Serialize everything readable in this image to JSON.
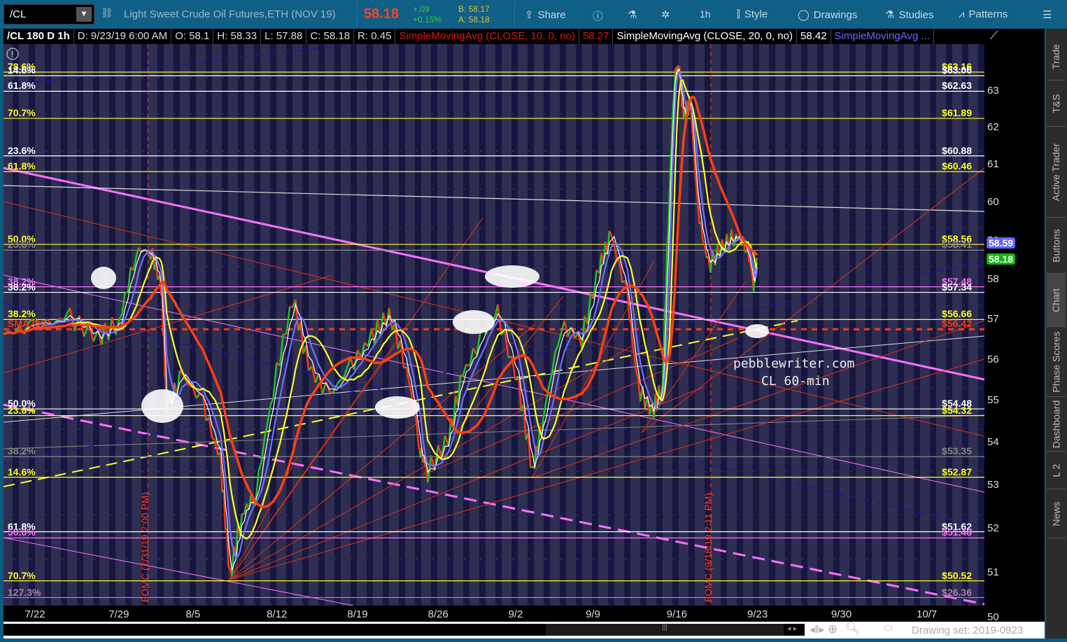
{
  "toolbar": {
    "symbol": "/CL",
    "description": "Light Sweet Crude Oil Futures,ETH (NOV 19)",
    "last": "58.18",
    "change": "+.09",
    "change_pct": "+0.15%",
    "bid": "B: 58.17",
    "ask": "A: 58.18",
    "share": "Share",
    "interval": "1h",
    "style": "Style",
    "drawings": "Drawings",
    "studies": "Studies",
    "patterns": "Patterns"
  },
  "header": {
    "title": "/CL 180 D 1h",
    "date": "D: 9/23/19 6:00 AM",
    "open": "O: 58.1",
    "high": "H: 58.33",
    "low": "L: 57.88",
    "close": "C: 58.18",
    "range": "R: 0.45",
    "sma10": "SimpleMovingAvg (CLOSE, 10, 0, no)",
    "sma10_val": "58.27",
    "sma20": "SimpleMovingAvg (CLOSE, 20, 0, no)",
    "sma20_val": "58.42",
    "sma3": "SimpleMovingAvg ..."
  },
  "colors": {
    "up": "#22c422",
    "down": "#ff3a10",
    "sma_fast": "#7070ff",
    "sma_mid": "#ffff20",
    "sma_slow": "#ff4010",
    "white": "#ffffff",
    "magenta": "#ff70ff",
    "gray": "#888888"
  },
  "price_badges": {
    "blue": "58.59",
    "green": "58.18"
  },
  "watermark": {
    "line1": "pebblewriter.com",
    "line2": "CL 60-min"
  },
  "events": [
    {
      "label": "FOMC (7/31/19 2:00 PM)",
      "t": 7.0
    },
    {
      "label": "FOMC (9/18/19 2:11 PM)",
      "t": 41.9
    }
  ],
  "tabs": [
    "Trade",
    "T&S",
    "Active Trader",
    "Buttons",
    "Chart",
    "Phase Scores",
    "Dashboard",
    "L 2",
    "News"
  ],
  "footer": {
    "drawing_set": "Drawing set: 2019-0923"
  },
  "chart_data": {
    "type": "line",
    "title": "/CL 180 D 1h",
    "xlabel": "",
    "ylabel": "",
    "ylim": [
      50,
      63.5
    ],
    "y_ticks": [
      50,
      51,
      52,
      53,
      54,
      55,
      56,
      57,
      58,
      59,
      60,
      61,
      62,
      63
    ],
    "x_unit": "trading days from 7/22",
    "x_ticks": [
      {
        "label": "7/22",
        "t": 0
      },
      {
        "label": "7/29",
        "t": 5.2
      },
      {
        "label": "8/5",
        "t": 9.8
      },
      {
        "label": "8/12",
        "t": 15
      },
      {
        "label": "8/19",
        "t": 20
      },
      {
        "label": "8/26",
        "t": 25
      },
      {
        "label": "9/2",
        "t": 29.8
      },
      {
        "label": "9/9",
        "t": 34.6
      },
      {
        "label": "9/16",
        "t": 39.8
      },
      {
        "label": "9/23",
        "t": 44.8
      },
      {
        "label": "9/30",
        "t": 50
      },
      {
        "label": "10/7",
        "t": 55.3
      }
    ],
    "price": {
      "t": [
        -1.96,
        0,
        2.17,
        3.91,
        5.22,
        6.3,
        7.17,
        7.83,
        8.17,
        9.13,
        10.43,
        11.52,
        12.09,
        12.83,
        13.7,
        14.78,
        16,
        16.96,
        18.26,
        19.57,
        20.87,
        21.96,
        23.04,
        23.91,
        24.35,
        25.65,
        26.52,
        27.83,
        28.7,
        30,
        30.87,
        31.52,
        32.61,
        33.91,
        35,
        35.74,
        36.74,
        37.39,
        38.26,
        38.91,
        39.35,
        39.65,
        39.91,
        40.22,
        40.65,
        41.09,
        41.74,
        42.61,
        43.48,
        44.13,
        44.57,
        44.78
      ],
      "close": [
        56.3,
        56.5,
        56.7,
        56.2,
        56.6,
        58.4,
        58.4,
        57.5,
        54.5,
        55.3,
        54.6,
        53.2,
        50.6,
        52.0,
        52.5,
        55.0,
        57.2,
        55.5,
        54.8,
        55.5,
        56.2,
        56.8,
        55.5,
        53.5,
        53.0,
        53.8,
        55.3,
        56.3,
        56.8,
        55.0,
        53.0,
        54.3,
        56.5,
        56.2,
        58.0,
        58.8,
        57.2,
        55.0,
        54.4,
        55.0,
        60.0,
        63.0,
        63.3,
        62.0,
        62.3,
        59.5,
        58.0,
        58.5,
        58.8,
        58.5,
        57.6,
        58.18
      ]
    },
    "levels": [
      {
        "pct": "78.6%",
        "price": 63.16,
        "label": "$63.16",
        "color": "#ffff20"
      },
      {
        "pct": "14.6%",
        "price": 63.06,
        "label": "$63.06",
        "color": "#ffffff"
      },
      {
        "pct": "61.8%",
        "price": 62.63,
        "label": "$62.63",
        "color": "#ffffff"
      },
      {
        "pct": "70.7%",
        "price": 61.89,
        "label": "$61.89",
        "color": "#ffff20"
      },
      {
        "pct": "23.6%",
        "price": 60.88,
        "label": "$60.88",
        "color": "#ffffff"
      },
      {
        "pct": "61.8%",
        "price": 60.46,
        "label": "$60.46",
        "color": "#ffff20"
      },
      {
        "pct": "50.0%",
        "price": 58.56,
        "label": "$58.56",
        "color": "#ffff20"
      },
      {
        "pct": "23.6%",
        "price": 58.41,
        "label": "$58.41",
        "color": "#888888"
      },
      {
        "pct": "38.2%",
        "price": 57.48,
        "label": "$57.48",
        "color": "#ff70ff"
      },
      {
        "pct": "38.2%",
        "price": 57.34,
        "label": "$57.34",
        "color": "#ffffff"
      },
      {
        "pct": "38.2%",
        "price": 56.66,
        "label": "$56.66",
        "color": "#ffff20"
      },
      {
        "pct": "SMA200",
        "price": 56.42,
        "label": "$56.42",
        "color": "#ff3a10",
        "dotted": true
      },
      {
        "pct": "50.0%",
        "price": 54.48,
        "label": "$54.48",
        "color": "#ffffff"
      },
      {
        "pct": "23.6%",
        "price": 54.32,
        "label": "$54.32",
        "color": "#ffff20"
      },
      {
        "pct": "38.2%",
        "price": 53.35,
        "label": "$53.35",
        "color": "#888888"
      },
      {
        "pct": "14.6%",
        "price": 52.87,
        "label": "$52.87",
        "color": "#ffff20"
      },
      {
        "pct": "61.8%",
        "price": 51.62,
        "label": "$51.62",
        "color": "#ffffff"
      },
      {
        "pct": "50.0%",
        "price": 51.48,
        "label": "$51.48",
        "color": "#ff70ff"
      },
      {
        "pct": "70.7%",
        "price": 50.52,
        "label": "$50.52",
        "color": "#ffff20"
      },
      {
        "pct": "127.3%",
        "price": 50.15,
        "label": "$26.36",
        "color": "#b080b0"
      }
    ]
  }
}
